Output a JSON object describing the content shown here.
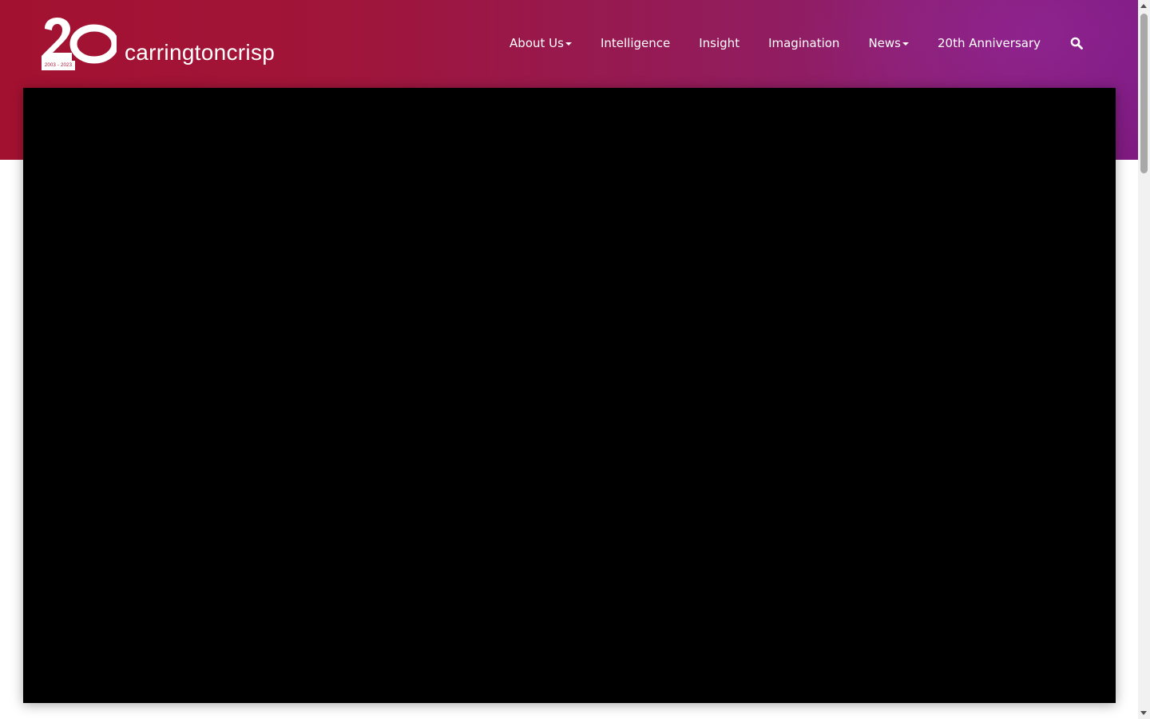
{
  "brand": {
    "logo_years": "2003 - 2023",
    "name": "carringtoncrisp"
  },
  "nav": {
    "items": [
      {
        "label": "About Us",
        "dropdown": true
      },
      {
        "label": "Intelligence",
        "dropdown": false
      },
      {
        "label": "Insight",
        "dropdown": false
      },
      {
        "label": "Imagination",
        "dropdown": false
      },
      {
        "label": "News",
        "dropdown": true
      },
      {
        "label": "20th Anniversary",
        "dropdown": false
      }
    ],
    "search_icon": "search-icon"
  },
  "colors": {
    "brand_red": "#a31130",
    "brand_purple": "#7d1a80",
    "video_bg": "#000000"
  }
}
